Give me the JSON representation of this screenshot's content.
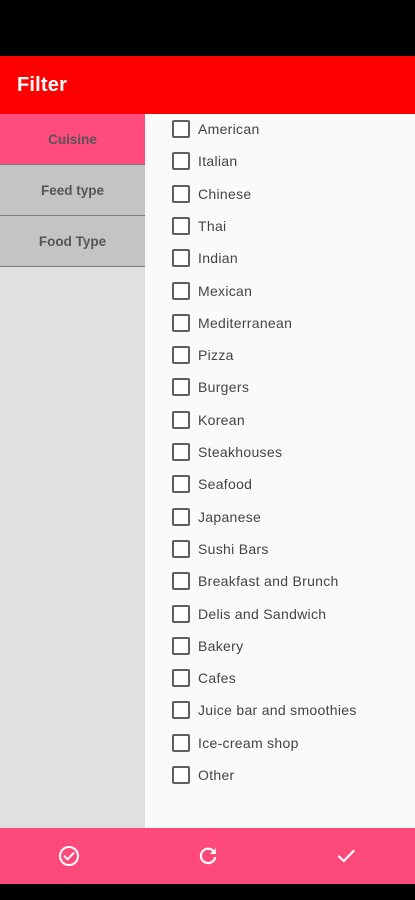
{
  "app_bar": {
    "title": "Filter"
  },
  "sidebar": {
    "tabs": [
      {
        "label": "Cuisine",
        "active": true
      },
      {
        "label": "Feed type",
        "active": false
      },
      {
        "label": "Food Type",
        "active": false
      }
    ]
  },
  "cuisine_options": [
    {
      "label": "American",
      "checked": false
    },
    {
      "label": "Italian",
      "checked": false
    },
    {
      "label": "Chinese",
      "checked": false
    },
    {
      "label": "Thai",
      "checked": false
    },
    {
      "label": "Indian",
      "checked": false
    },
    {
      "label": "Mexican",
      "checked": false
    },
    {
      "label": "Mediterranean",
      "checked": false
    },
    {
      "label": "Pizza",
      "checked": false
    },
    {
      "label": "Burgers",
      "checked": false
    },
    {
      "label": "Korean",
      "checked": false
    },
    {
      "label": "Steakhouses",
      "checked": false
    },
    {
      "label": "Seafood",
      "checked": false
    },
    {
      "label": "Japanese",
      "checked": false
    },
    {
      "label": "Sushi Bars",
      "checked": false
    },
    {
      "label": "Breakfast and Brunch",
      "checked": false
    },
    {
      "label": "Delis and Sandwich",
      "checked": false
    },
    {
      "label": "Bakery",
      "checked": false
    },
    {
      "label": "Cafes",
      "checked": false
    },
    {
      "label": "Juice bar and smoothies",
      "checked": false
    },
    {
      "label": "Ice-cream shop",
      "checked": false
    },
    {
      "label": "Other",
      "checked": false
    }
  ],
  "bottom_bar": {
    "buttons": [
      {
        "icon": "check-circle-icon"
      },
      {
        "icon": "refresh-icon"
      },
      {
        "icon": "check-icon"
      }
    ]
  },
  "colors": {
    "app_bar": "#ff0000",
    "active_tab": "#ff4b7d",
    "inactive_tab": "#c4c4c4",
    "sidebar_bg": "#e0e0e0",
    "bottom_bar": "#fe4a7b"
  }
}
